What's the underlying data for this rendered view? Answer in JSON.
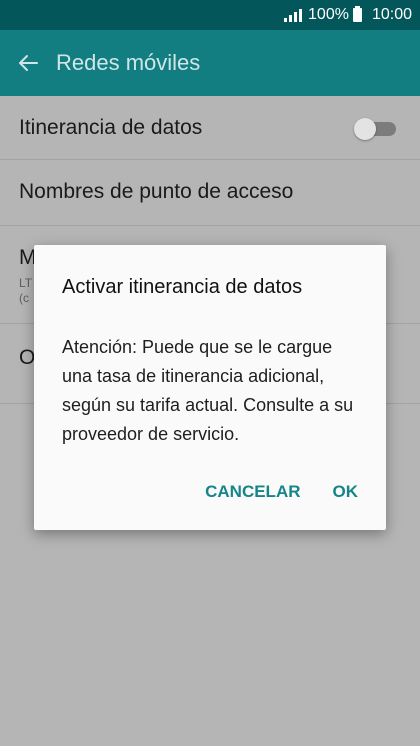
{
  "status_bar": {
    "battery_percent": "100%",
    "time": "10:00"
  },
  "app_bar": {
    "title": "Redes móviles",
    "back_icon": "arrow-left-icon"
  },
  "settings": {
    "data_roaming": {
      "label": "Itinerancia de datos",
      "toggle_on": false
    },
    "access_point_names": {
      "label": "Nombres de punto de acceso"
    },
    "network_mode": {
      "label_visible": "M",
      "sub1_visible": "LT",
      "sub2_visible": "(c"
    },
    "network_operators": {
      "label_visible": "O"
    }
  },
  "dialog": {
    "title": "Activar itinerancia de datos",
    "message": "Atención: Puede que se le cargue una tasa de itinerancia adicional, según su tarifa actual. Consulte a su proveedor de servicio.",
    "cancel_label": "CANCELAR",
    "ok_label": "OK"
  },
  "colors": {
    "status_bar": "#03565a",
    "app_bar": "#137e82",
    "accent": "#15858a",
    "scrim_background": "#b5b5b5"
  }
}
